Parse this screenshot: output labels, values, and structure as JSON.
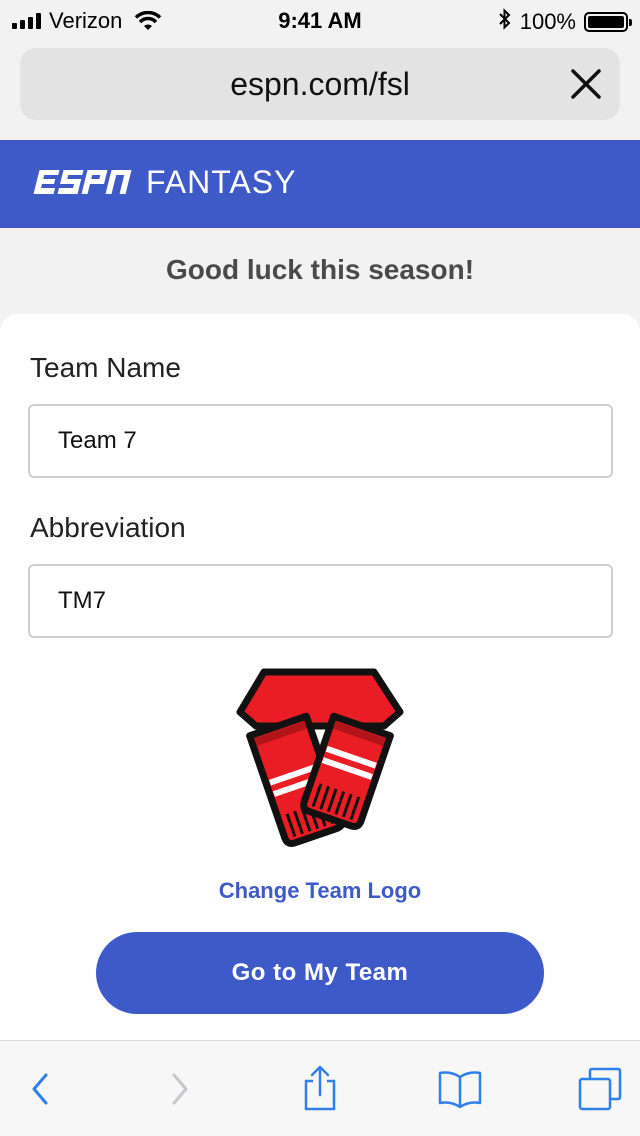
{
  "status_bar": {
    "carrier": "Verizon",
    "time": "9:41 AM",
    "battery_percent": "100%",
    "battery_level": 1.0
  },
  "browser": {
    "url": "espn.com/fsl"
  },
  "header": {
    "brand": "ESPN",
    "product": "FANTASY",
    "brand_color": "#3e5ac8"
  },
  "greeting": "Good luck this season!",
  "form": {
    "team_name_label": "Team Name",
    "team_name_value": "Team 7",
    "abbreviation_label": "Abbreviation",
    "abbreviation_value": "TM7"
  },
  "logo": {
    "icon": "scarf-icon",
    "change_label": "Change Team Logo"
  },
  "cta_label": "Go to My Team",
  "toolbar": {
    "items": [
      "back-icon",
      "forward-icon",
      "share-icon",
      "bookmarks-icon",
      "tabs-icon"
    ]
  }
}
